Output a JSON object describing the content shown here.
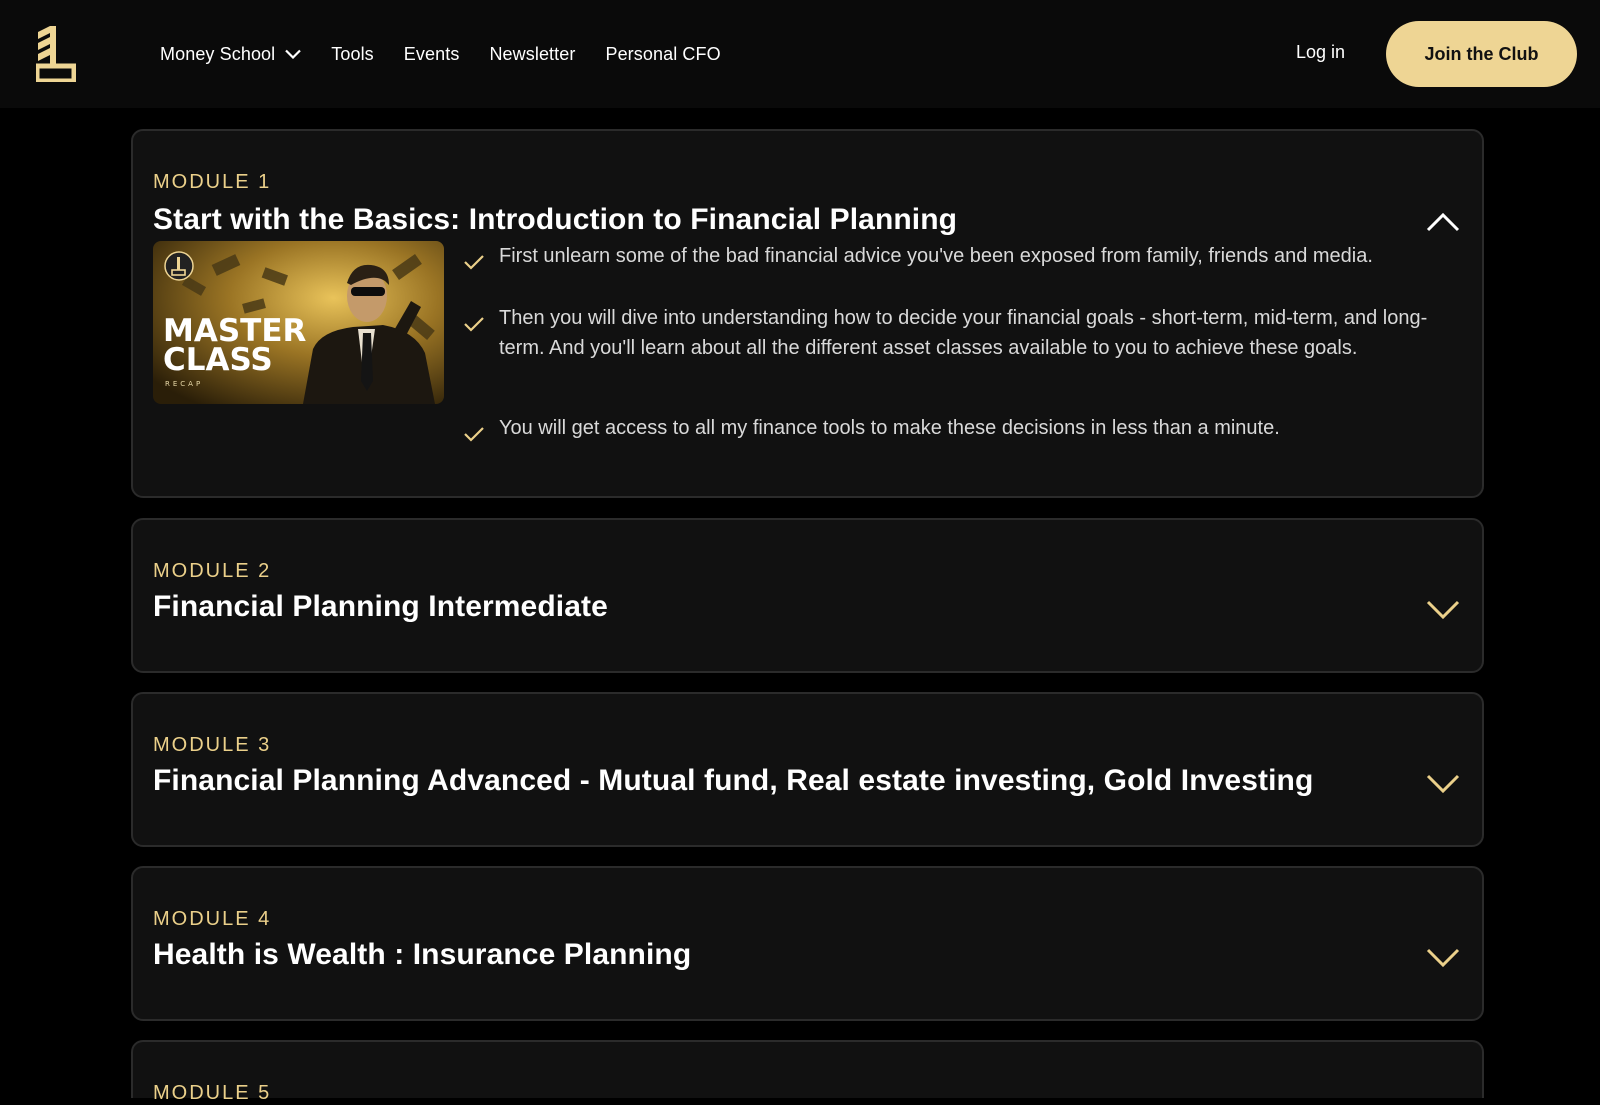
{
  "header": {
    "logo_icon": "brand-logo-icon",
    "nav": [
      {
        "label": "Money School",
        "has_dropdown": true
      },
      {
        "label": "Tools"
      },
      {
        "label": "Events"
      },
      {
        "label": "Newsletter"
      },
      {
        "label": "Personal CFO"
      }
    ],
    "login_label": "Log in",
    "cta_label": "Join the Club"
  },
  "colors": {
    "accent": "#eed594",
    "module_label": "#ebd08a",
    "card_bg": "#111111",
    "page_bg": "#000000"
  },
  "modules": [
    {
      "label": "MODULE 1",
      "title": "Start with the Basics: Introduction to Financial Planning",
      "expanded": true,
      "thumbnail": {
        "line1": "MASTER",
        "line2": "CLASS",
        "line3": "RECAP"
      },
      "bullets": [
        "First unlearn some of the bad financial advice you've been exposed from family, friends and media.",
        "Then you will dive into understanding how to decide your financial goals - short-term, mid-term, and long-term. And you'll learn about all the different asset classes available to you to achieve these goals.",
        "You will get access to all my finance tools to make these decisions in less than a minute."
      ]
    },
    {
      "label": "MODULE 2",
      "title": "Financial Planning Intermediate",
      "expanded": false
    },
    {
      "label": "MODULE 3",
      "title": "Financial Planning Advanced - Mutual fund, Real estate investing, Gold Investing",
      "expanded": false
    },
    {
      "label": "MODULE 4",
      "title": "Health is Wealth : Insurance Planning",
      "expanded": false
    },
    {
      "label": "MODULE 5",
      "expanded": false
    }
  ]
}
